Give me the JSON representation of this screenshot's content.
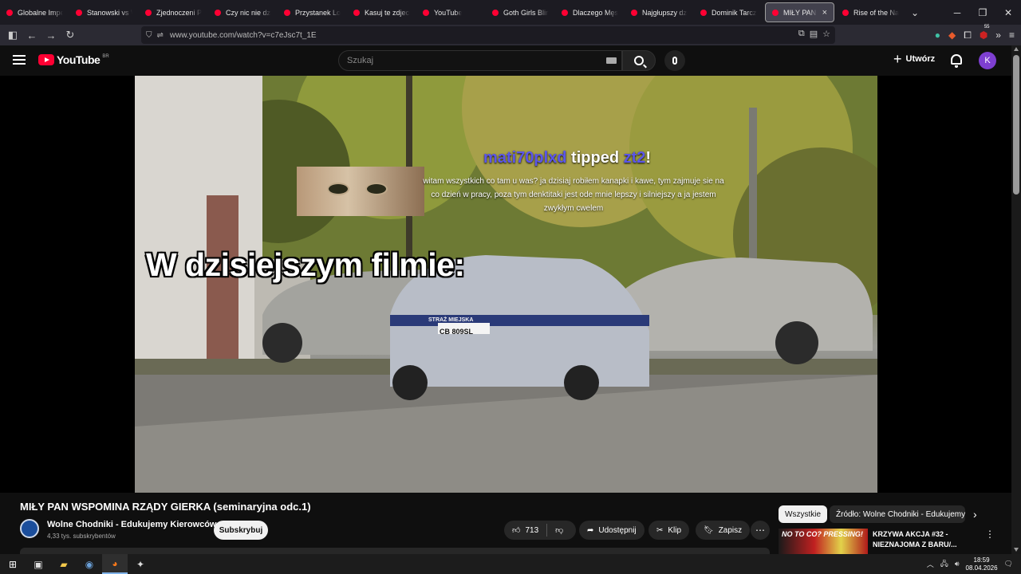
{
  "browser": {
    "tabs": [
      {
        "label": "Globalne Imperi"
      },
      {
        "label": "Stanowski vs Wo"
      },
      {
        "label": "Zjednoczeni Prze"
      },
      {
        "label": "Czy nic nie dzieje"
      },
      {
        "label": "Przystanek Lomb"
      },
      {
        "label": "Kasuj te zdjecia a"
      },
      {
        "label": "YouTube"
      },
      {
        "label": "Goth Girls Blind"
      },
      {
        "label": "Dlaczego Męska"
      },
      {
        "label": "Najgłupszy dzie"
      },
      {
        "label": "Dominik Tarczyń"
      },
      {
        "label": "MIŁY PAN WS"
      },
      {
        "label": "Rise of the Nazis"
      }
    ],
    "active_tab_index": 11,
    "url": "www.youtube.com/watch?v=c7eJsc7t_1E",
    "ext_badge": "55"
  },
  "youtube": {
    "logo_text": "YouTube",
    "country_code": "BR",
    "search_placeholder": "Szukaj",
    "create_label": "Utwórz",
    "avatar_letter": "K"
  },
  "video": {
    "tip_user": "mati70plxd",
    "tip_action": "tipped",
    "tip_target": "zt2",
    "tip_suffix": "!",
    "tip_message": "witam wszystkich co tam u was? ja dzisiaj robiłem kanapki i kawe, tym zajmuje sie na co dzień w pracy, poza tym denktitaki jest ode mnie lepszy i silniejszy a ja jestem zwykłym cwelem",
    "overlay_headline": "W dzisiejszym filmie:",
    "plate_text": "CB 809SL",
    "car_text": "STRAŻ MIEJSKA"
  },
  "meta": {
    "title": "MIŁY PAN WSPOMINA RZĄDY GIERKA (seminaryjna odc.1)",
    "channel_name": "Wolne Chodniki - Edukujemy Kierowców",
    "subscribers": "4,33 tys. subskrybentów",
    "subscribe_label": "Subskrybuj",
    "likes": "713",
    "share_label": "Udostępnij",
    "clip_label": "Klip",
    "save_label": "Zapisz"
  },
  "sidebar": {
    "chips": [
      "Wszystkie",
      "Źródło: Wolne Chodniki - Edukujemy K"
    ],
    "rec_thumb_text": "NO TO CO? PRESSING!",
    "rec_title": "KRZYWA AKCJA #32 - NIEZNAJOMA Z BARU/..."
  },
  "taskbar": {
    "time": "18:59",
    "date": "08.04.2026"
  },
  "colors": {
    "youtube_red": "#ff0033",
    "tip_name": "#5b56e8",
    "avatar": "#7e3fd1"
  }
}
